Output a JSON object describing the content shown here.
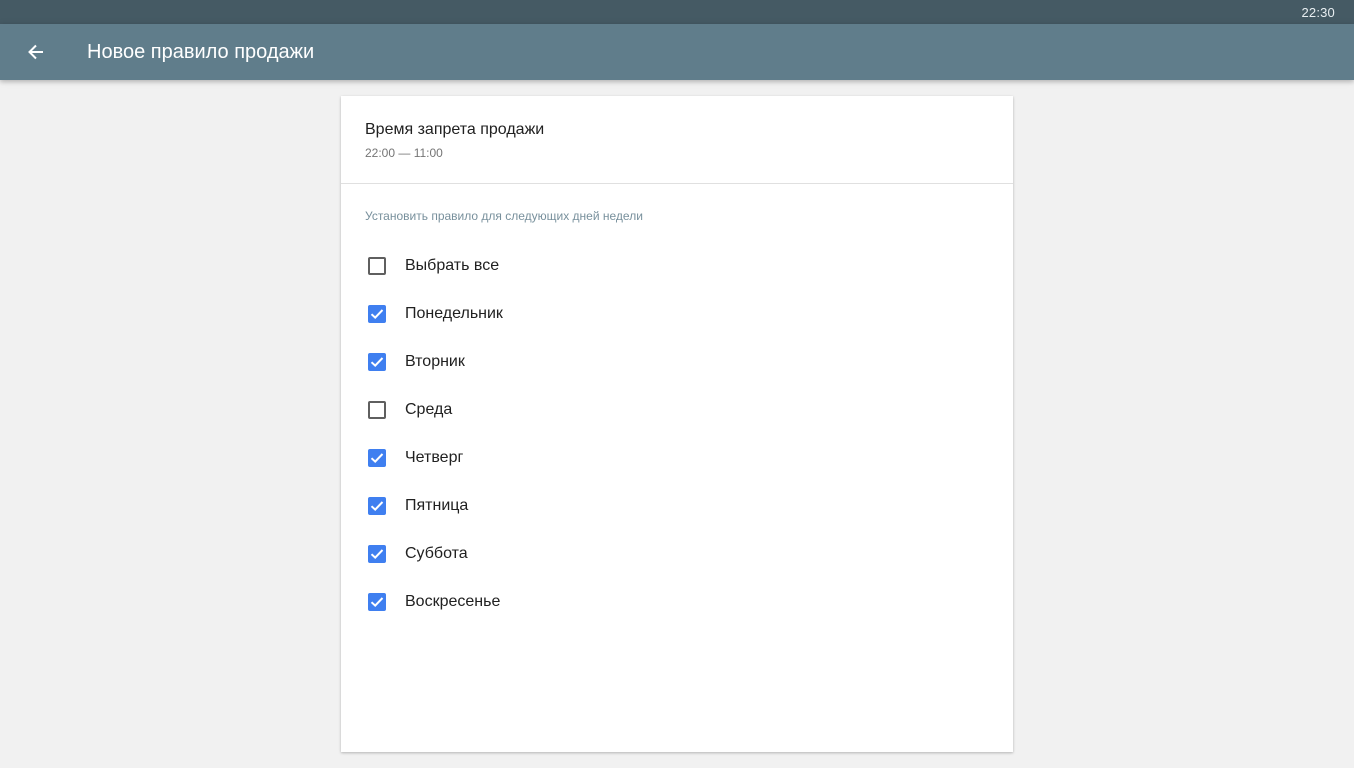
{
  "status_bar": {
    "time": "22:30"
  },
  "app_bar": {
    "back_icon": "arrow-back-icon",
    "title": "Новое правило продажи"
  },
  "time_restriction": {
    "label": "Время запрета продажи",
    "value": "22:00 — 11:00"
  },
  "days_section": {
    "caption": "Установить правило для следующих дней недели",
    "check_color": "#3f7ff0",
    "items": [
      {
        "label": "Выбрать все",
        "checked": false
      },
      {
        "label": "Понедельник",
        "checked": true
      },
      {
        "label": "Вторник",
        "checked": true
      },
      {
        "label": "Среда",
        "checked": false
      },
      {
        "label": "Четверг",
        "checked": true
      },
      {
        "label": "Пятница",
        "checked": true
      },
      {
        "label": "Суббота",
        "checked": true
      },
      {
        "label": "Воскресенье",
        "checked": true
      }
    ]
  }
}
